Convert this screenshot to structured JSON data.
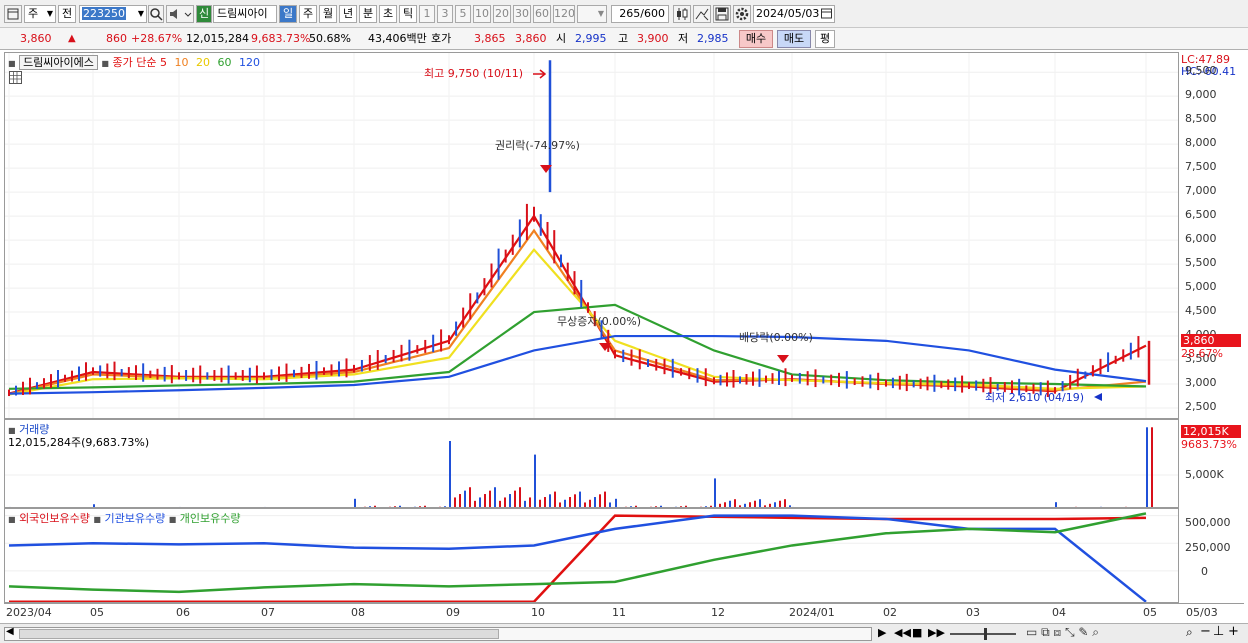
{
  "toolbar": {
    "period_type": "주",
    "compare_label": "전",
    "stock_code": "223250",
    "new_badge": "신",
    "stock_name": "드림씨아이",
    "periods": [
      "일",
      "주",
      "월",
      "년",
      "분",
      "초",
      "틱"
    ],
    "active_period": "일",
    "counts": [
      "1",
      "3",
      "5",
      "10",
      "20",
      "30",
      "60",
      "120"
    ],
    "view_count": "265",
    "view_total": "/600",
    "date": "2024/05/03"
  },
  "quote": {
    "price": "3,860",
    "change": "860",
    "change_pct": "+28.67%",
    "volume": "12,015,284",
    "volume_ratio": "9,683.73%",
    "turnover": "50.68%",
    "amount": "43,406백만",
    "ask_label": "호가",
    "ask": "3,865",
    "bid": "3,860",
    "open_label": "시",
    "open": "2,995",
    "high_label": "고",
    "high": "3,900",
    "low_label": "저",
    "low": "2,985",
    "buy_button": "매수",
    "sell_button": "매도",
    "eval_button": "평"
  },
  "price_pane": {
    "stock_tag": "드림씨아이에스",
    "ma_label": "종가 단순",
    "ma_periods": [
      "5",
      "10",
      "20",
      "60",
      "120"
    ],
    "lc": "LC:47.89",
    "hc": "HC:-60.41",
    "current_price_tag": "3,860",
    "current_pct_tag": "28.67%",
    "annotations": {
      "high": "최고 9,750 (10/11)",
      "rights": "권리락(-74.97%)",
      "bonus": "무상증자(0.00%)",
      "dividend": "배당락(0.00%)",
      "low": "최저 2,610 (04/19)"
    }
  },
  "volume_pane": {
    "title": "거래량",
    "readout": "12,015,284주(9,683.73%)",
    "current_tag": "12,015K",
    "current_pct_tag": "9683.73%",
    "tick": "5,000K"
  },
  "holdings_pane": {
    "legend": [
      "외국인보유수량",
      "기관보유수량",
      "개인보유수량"
    ],
    "ticks": [
      "500,000",
      "250,000",
      "0"
    ]
  },
  "dates": [
    "2023/04",
    "05",
    "06",
    "07",
    "08",
    "09",
    "10",
    "11",
    "12",
    "2024/01",
    "02",
    "03",
    "04",
    "05",
    "05/03"
  ],
  "chart_data": [
    {
      "type": "line",
      "title": "",
      "description_series": "candles with moving averages",
      "y_ticks": [
        2500,
        3000,
        3500,
        4000,
        4500,
        5000,
        5500,
        6000,
        6500,
        7000,
        7500,
        8000,
        8500,
        9000,
        9500
      ],
      "ylim": [
        2250,
        9900
      ],
      "x": [
        "2023/04",
        "05",
        "06",
        "07",
        "08",
        "09",
        "10",
        "11",
        "12",
        "2024/01",
        "02",
        "03",
        "04",
        "05"
      ],
      "series": [
        {
          "name": "5",
          "color": "#e01010",
          "values": [
            2800,
            3250,
            3150,
            3150,
            3300,
            3900,
            6500,
            3600,
            3050,
            3100,
            3000,
            2950,
            2850,
            3800
          ]
        },
        {
          "name": "10",
          "color": "#f08020",
          "values": [
            2790,
            3200,
            3130,
            3120,
            3250,
            3750,
            6200,
            3700,
            3080,
            3090,
            3000,
            2970,
            2870,
            3050
          ]
        },
        {
          "name": "20",
          "color": "#f0e020",
          "values": [
            2780,
            3100,
            3120,
            3100,
            3200,
            3550,
            5800,
            3900,
            3150,
            3080,
            3020,
            2990,
            2900,
            2950
          ]
        },
        {
          "name": "60",
          "color": "#30a030",
          "values": [
            2900,
            2930,
            2970,
            3000,
            3050,
            3250,
            4500,
            4650,
            3700,
            3200,
            3080,
            3030,
            3000,
            2950
          ]
        },
        {
          "name": "120",
          "color": "#2050e0",
          "values": [
            2800,
            2830,
            2870,
            2920,
            2980,
            3150,
            3700,
            4000,
            4000,
            3980,
            3900,
            3700,
            3300,
            3060
          ]
        }
      ]
    },
    {
      "type": "bar",
      "title": "거래량",
      "ylim": [
        0,
        12500000
      ],
      "x": [
        "2023/04",
        "05",
        "06",
        "07",
        "08",
        "09",
        "10",
        "11",
        "12",
        "2024/01",
        "02",
        "03",
        "04",
        "05"
      ],
      "values": [
        300000,
        700000,
        300000,
        300000,
        1500000,
        10000000,
        8000000,
        1500000,
        4500000,
        300000,
        200000,
        200000,
        1000000,
        12015284
      ]
    },
    {
      "type": "line",
      "title": "보유수량",
      "y_ticks": [
        500000,
        250000,
        0
      ],
      "x": [
        "2023/04",
        "05",
        "06",
        "07",
        "08",
        "09",
        "10",
        "11",
        "12",
        "2024/01",
        "02",
        "03",
        "04",
        "05"
      ],
      "series": [
        {
          "name": "외국인보유수량",
          "color": "#e01010",
          "values": [
            -280000,
            -280000,
            -280000,
            -280000,
            -280000,
            -280000,
            -280000,
            500000,
            490000,
            480000,
            470000,
            470000,
            470000,
            480000
          ]
        },
        {
          "name": "기관보유수량",
          "color": "#2050e0",
          "values": [
            230000,
            250000,
            240000,
            250000,
            210000,
            200000,
            230000,
            380000,
            500000,
            500000,
            470000,
            380000,
            380000,
            -280000
          ]
        },
        {
          "name": "개인보유수량",
          "color": "#30a030",
          "values": [
            -140000,
            -170000,
            -190000,
            -150000,
            -120000,
            -140000,
            -120000,
            -100000,
            100000,
            230000,
            340000,
            380000,
            350000,
            520000
          ]
        }
      ]
    }
  ]
}
